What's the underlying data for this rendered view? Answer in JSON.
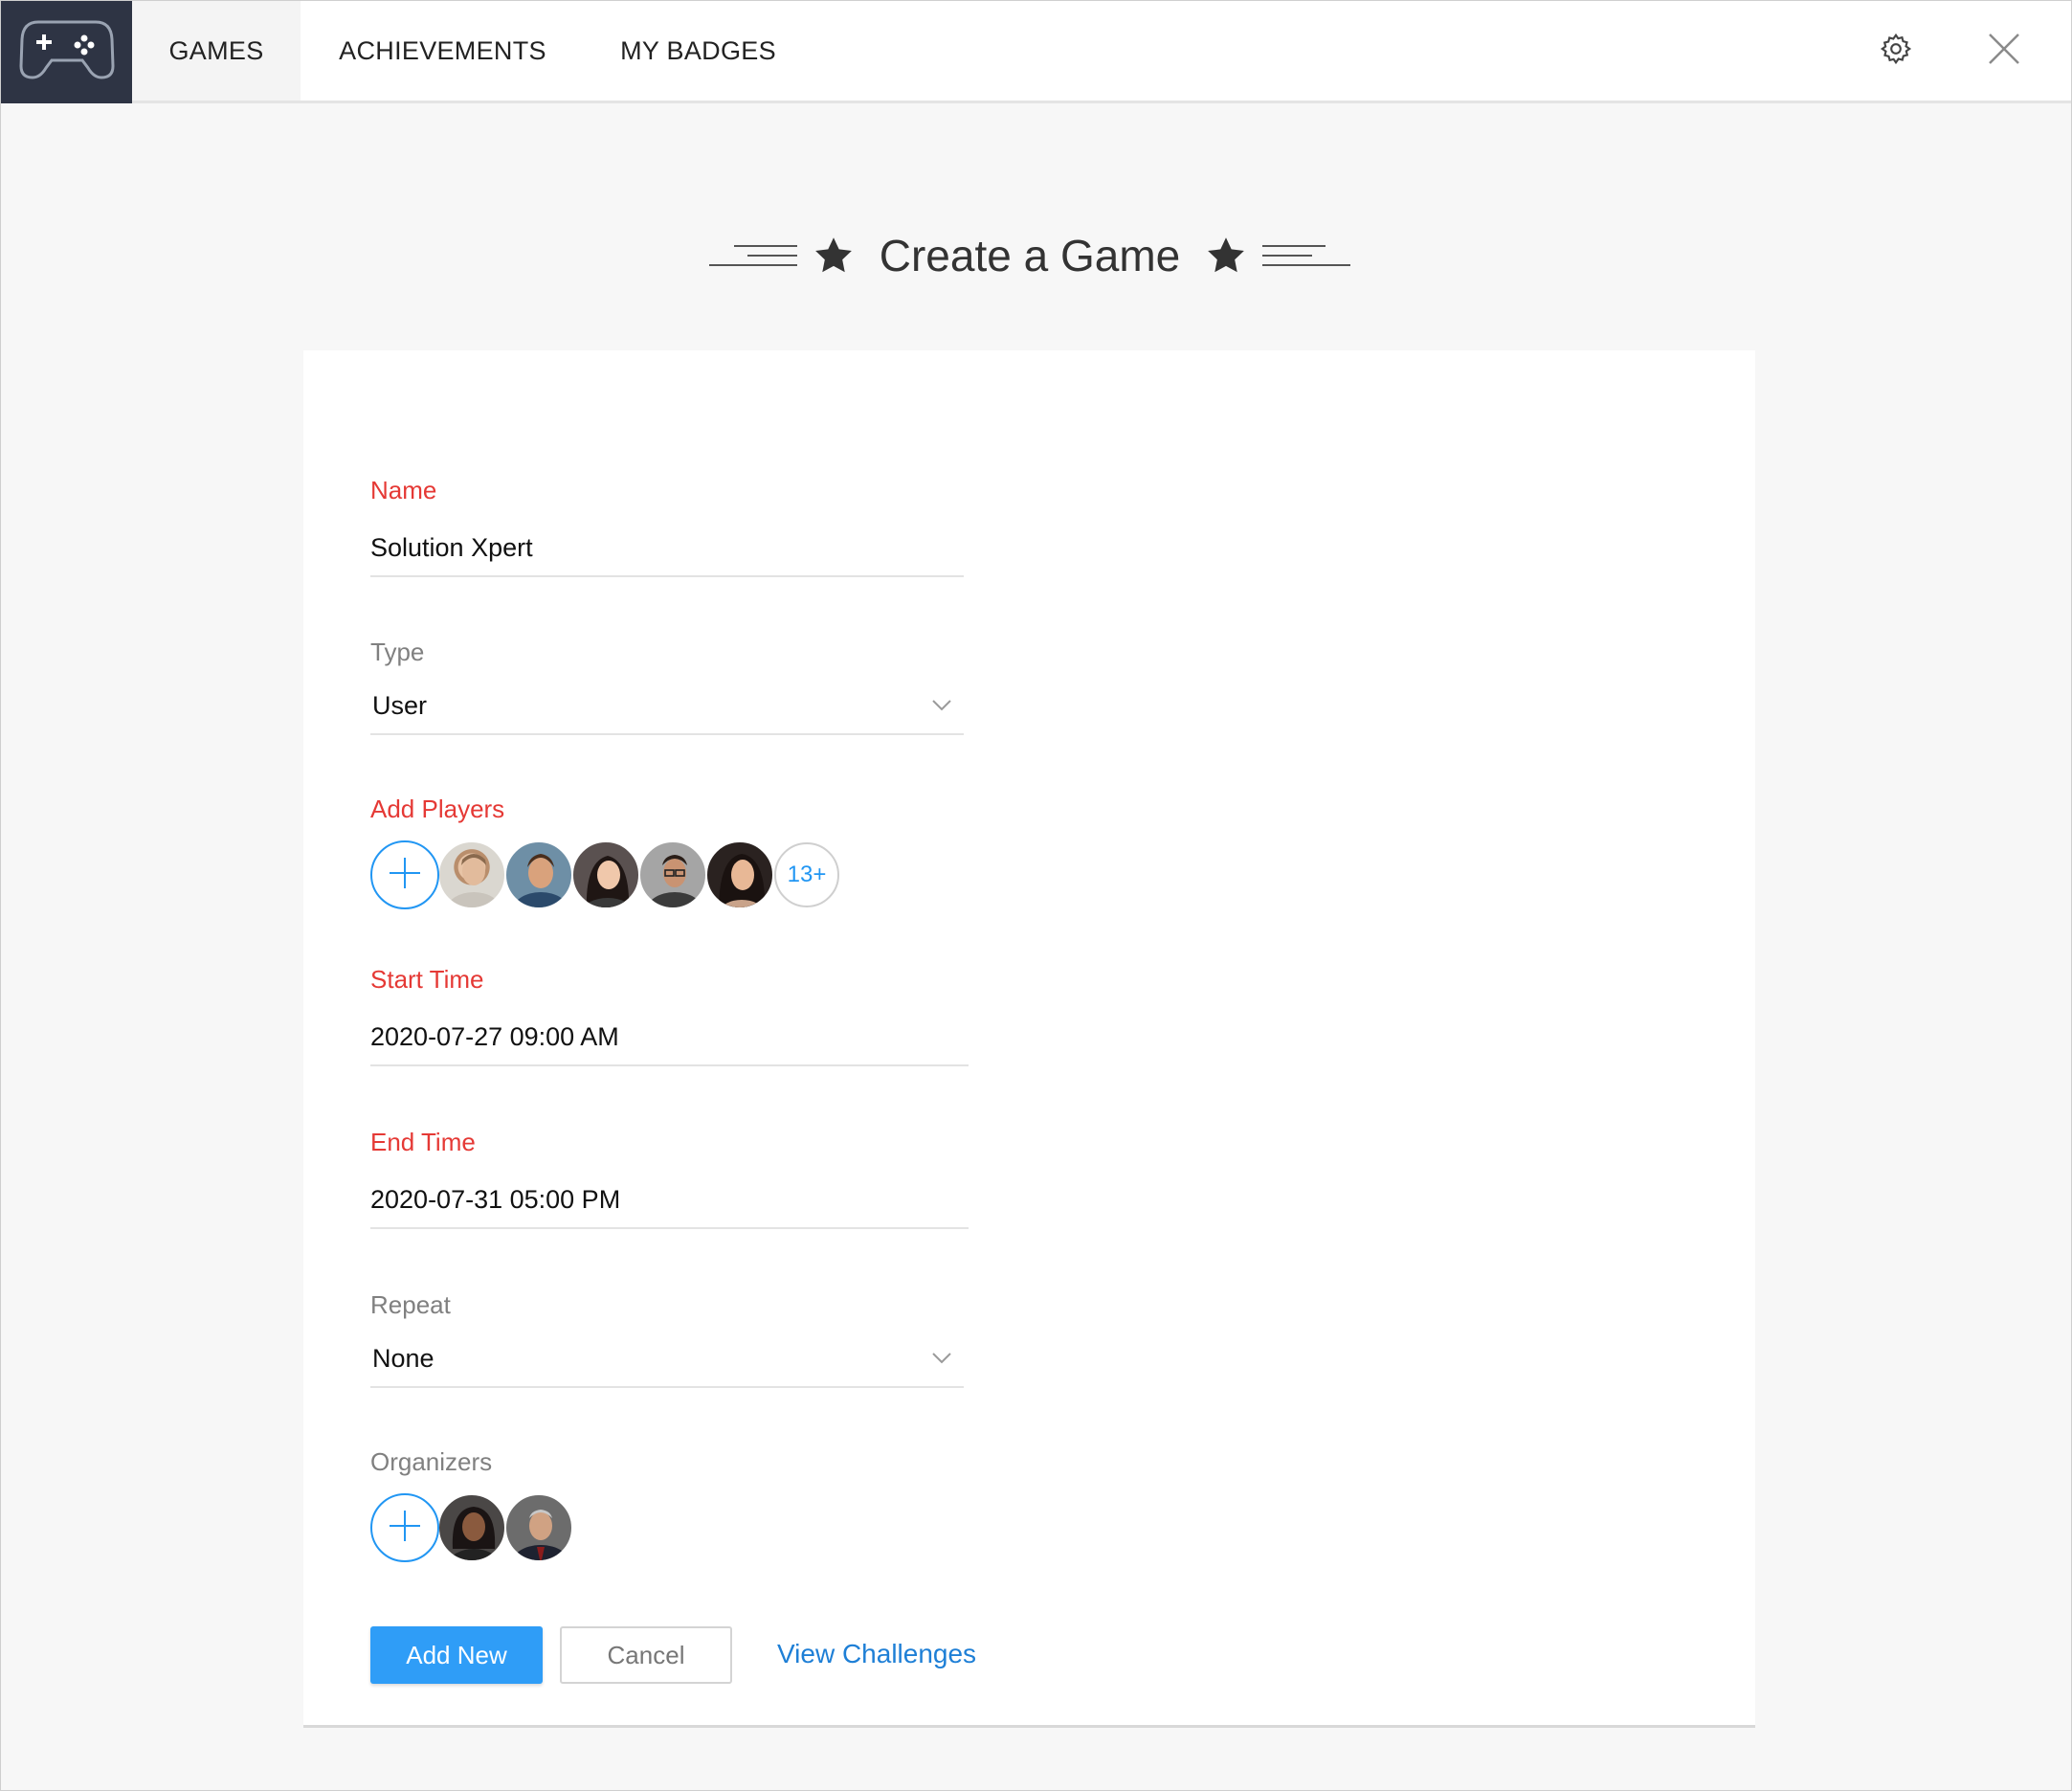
{
  "nav": {
    "tabs": [
      {
        "label": "GAMES",
        "active": true
      },
      {
        "label": "ACHIEVEMENTS",
        "active": false
      },
      {
        "label": "MY BADGES",
        "active": false
      }
    ],
    "logo_icon": "gamepad-icon",
    "settings_icon": "gear-icon",
    "close_icon": "close-icon"
  },
  "heading": {
    "title": "Create a Game"
  },
  "form": {
    "name": {
      "label": "Name",
      "value": "Solution Xpert"
    },
    "type": {
      "label": "Type",
      "value": "User"
    },
    "players": {
      "label": "Add Players",
      "more_count": "13+"
    },
    "start_time": {
      "label": "Start Time",
      "value": "2020-07-27 09:00 AM"
    },
    "end_time": {
      "label": "End Time",
      "value": "2020-07-31 05:00 PM"
    },
    "repeat": {
      "label": "Repeat",
      "value": "None"
    },
    "organizers": {
      "label": "Organizers"
    }
  },
  "actions": {
    "add_new": "Add New",
    "cancel": "Cancel",
    "view_challenges": "View Challenges"
  },
  "colors": {
    "required_label": "#e53935",
    "accent": "#2f9df7",
    "link": "#1e7fd6",
    "logo_bg": "#2e3444"
  }
}
